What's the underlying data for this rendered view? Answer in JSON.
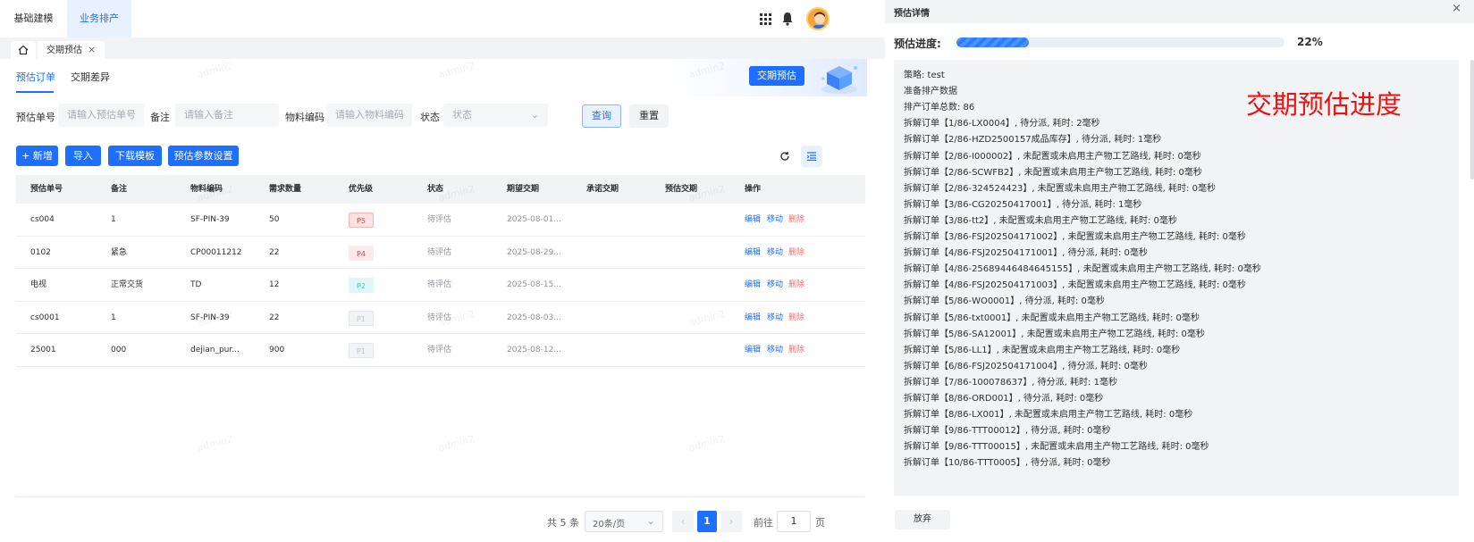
{
  "topnav": {
    "tabs": [
      {
        "label": "基础建模",
        "active": false
      },
      {
        "label": "业务排产",
        "active": true
      }
    ],
    "icons": [
      "apps-grid-icon",
      "bell-icon",
      "avatar"
    ]
  },
  "tagbar": {
    "home_icon": "home-icon",
    "current_tag": "交期预估",
    "close_glyph": "×"
  },
  "subtabs": [
    "预估订单",
    "交期差异"
  ],
  "banner": {
    "button_label": "交期预估"
  },
  "watermark_text": "admin2",
  "filters": {
    "order_no": {
      "label": "预估单号",
      "placeholder": "请输入预估单号"
    },
    "remark": {
      "label": "备注",
      "placeholder": "请输入备注"
    },
    "material": {
      "label": "物料编码",
      "placeholder": "请输入物料编码"
    },
    "status": {
      "label": "状态",
      "placeholder": "状态"
    },
    "query_label": "查询",
    "reset_label": "重置"
  },
  "toolbar": {
    "add_label": "+ 新增",
    "import_label": "导入",
    "download_label": "下载模板",
    "params_label": "预估参数设置",
    "refresh_icon": "refresh-icon",
    "columns_icon": "column-settings-icon"
  },
  "table": {
    "columns": [
      "预估单号",
      "备注",
      "物料编码",
      "需求数量",
      "优先级",
      "状态",
      "期望交期",
      "承诺交期",
      "预估交期",
      "操作"
    ],
    "rows": [
      {
        "order_no": "cs004",
        "remark": "1",
        "material": "SF-PIN-39",
        "qty": "50",
        "priority": "P5",
        "status": "待评估",
        "expected": "2025-08-01...",
        "promised": "",
        "estimated": ""
      },
      {
        "order_no": "0102",
        "remark": "紧急",
        "material": "CP00011212",
        "qty": "22",
        "priority": "P4",
        "status": "待评估",
        "expected": "2025-08-29...",
        "promised": "",
        "estimated": ""
      },
      {
        "order_no": "电视",
        "remark": "正常交货",
        "material": "TD",
        "qty": "12",
        "priority": "P2",
        "status": "待评估",
        "expected": "2025-08-15...",
        "promised": "",
        "estimated": ""
      },
      {
        "order_no": "cs0001",
        "remark": "1",
        "material": "SF-PIN-39",
        "qty": "22",
        "priority": "P1",
        "status": "待评估",
        "expected": "2025-08-03...",
        "promised": "",
        "estimated": ""
      },
      {
        "order_no": "25001",
        "remark": "000",
        "material": "dejian_pur...",
        "qty": "900",
        "priority": "P1",
        "status": "待评估",
        "expected": "2025-08-12...",
        "promised": "",
        "estimated": ""
      }
    ],
    "actions": {
      "edit": "编辑",
      "move": "移动",
      "delete": "删除"
    },
    "priority_colors": {
      "P5": {
        "bg": "#fde2e2",
        "fg": "#e04848",
        "border": "#f5b5b5"
      },
      "P4": {
        "bg": "#fde8ec",
        "fg": "#e0404f",
        "border": "#fde8ec"
      },
      "P2": {
        "bg": "#e0f7f7",
        "fg": "#39c6c6",
        "border": "#e0f7f7"
      },
      "P1": {
        "bg": "#f2f3f5",
        "fg": "#c0c4cc",
        "border": "#e4e7ed"
      }
    }
  },
  "pagination": {
    "total": "共 5 条",
    "page_size": "20条/页",
    "current_page": "1",
    "goto_label": "前往",
    "goto_value": "1",
    "page_suffix": "页"
  },
  "drawer": {
    "title": "预估详情",
    "close_glyph": "×",
    "progress_label": "预估进度:",
    "progress_value": 22,
    "progress_text": "22%",
    "annotation": "交期预估进度",
    "abandon_label": "放弃",
    "log_lines": [
      "策略: test",
      "准备排产数据",
      "排产订单总数: 86",
      "拆解订单【1/86-LX0004】, 待分派, 耗时: 2毫秒",
      "拆解订单【2/86-HZD2500157成品库存】, 待分派, 耗时: 1毫秒",
      "拆解订单【2/86-I000002】, 未配置或未启用主产物工艺路线, 耗时: 0毫秒",
      "拆解订单【2/86-SCWFB2】, 未配置或未启用主产物工艺路线, 耗时: 0毫秒",
      "拆解订单【2/86-324524423】, 未配置或未启用主产物工艺路线, 耗时: 0毫秒",
      "拆解订单【3/86-CG20250417001】, 待分派, 耗时: 1毫秒",
      "拆解订单【3/86-tt2】, 未配置或未启用主产物工艺路线, 耗时: 0毫秒",
      "拆解订单【3/86-FSJ202504171002】, 未配置或未启用主产物工艺路线, 耗时: 0毫秒",
      "拆解订单【4/86-FSJ202504171001】, 待分派, 耗时: 0毫秒",
      "拆解订单【4/86-25689446484645155】, 未配置或未启用主产物工艺路线, 耗时: 0毫秒",
      "拆解订单【4/86-FSJ202504171003】, 未配置或未启用主产物工艺路线, 耗时: 0毫秒",
      "拆解订单【5/86-WO0001】, 待分派, 耗时: 0毫秒",
      "拆解订单【5/86-txt0001】, 未配置或未启用主产物工艺路线, 耗时: 0毫秒",
      "拆解订单【5/86-SA12001】, 未配置或未启用主产物工艺路线, 耗时: 0毫秒",
      "拆解订单【5/86-LL1】, 未配置或未启用主产物工艺路线, 耗时: 0毫秒",
      "拆解订单【6/86-FSJ202504171004】, 待分派, 耗时: 0毫秒",
      "拆解订单【7/86-100078637】, 待分派, 耗时: 1毫秒",
      "拆解订单【8/86-ORD001】, 待分派, 耗时: 0毫秒",
      "拆解订单【8/86-LX001】, 未配置或未启用主产物工艺路线, 耗时: 0毫秒",
      "拆解订单【9/86-TTT00012】, 待分派, 耗时: 0毫秒",
      "拆解订单【9/86-TTT00015】, 未配置或未启用主产物工艺路线, 耗时: 0毫秒",
      "拆解订单【10/86-TTT0005】, 待分派, 耗时: 0毫秒"
    ]
  },
  "colors": {
    "primary": "#1f6fff",
    "danger": "#f56c6c",
    "annotation": "#ee1111"
  }
}
